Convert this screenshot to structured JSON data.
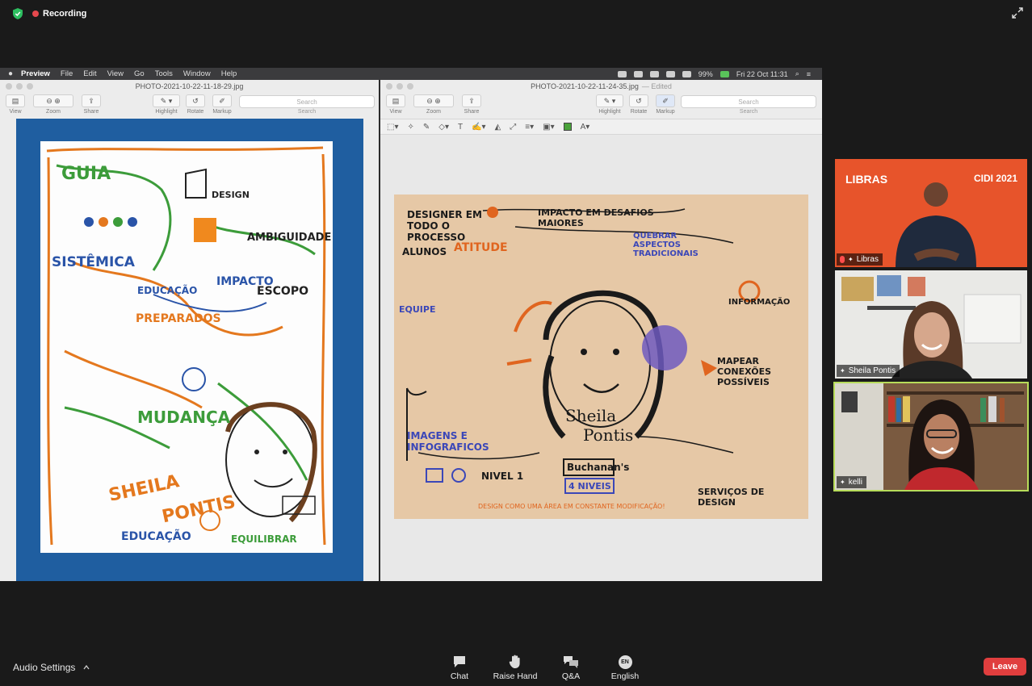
{
  "top_bar": {
    "recording_label": "Recording"
  },
  "mac_menubar": {
    "items": [
      "Preview",
      "File",
      "Edit",
      "View",
      "Go",
      "Tools",
      "Window",
      "Help"
    ],
    "battery": "99%",
    "clock": "Fri 22 Oct  11:31"
  },
  "preview_left": {
    "title": "PHOTO-2021-10-22-11-18-29.jpg",
    "toolbar": {
      "view": "View",
      "zoom": "Zoom",
      "share": "Share",
      "highlight": "Highlight",
      "rotate": "Rotate",
      "markup": "Markup",
      "search_placeholder": "Search",
      "search_label": "Search"
    },
    "sketch_text": {
      "guia": "GUIA",
      "sistemica": "SISTÊMICA",
      "impacto": "IMPACTO",
      "ambiguidade": "AMBIGUIDADE",
      "preparados": "PREPARADOS",
      "mudanca": "MUDANÇA",
      "sheila": "SHEILA",
      "pontis": "PONTIS",
      "educacao": "EDUCAÇÃO",
      "escopo": "ESCOPO",
      "equilibrar": "EQUILIBRAR",
      "design": "DESIGN"
    }
  },
  "preview_right": {
    "title": "PHOTO-2021-10-22-11-24-35.jpg",
    "edited": "— Edited",
    "toolbar": {
      "view": "View",
      "zoom": "Zoom",
      "share": "Share",
      "highlight": "Highlight",
      "rotate": "Rotate",
      "markup": "Markup",
      "search_placeholder": "Search",
      "search_label": "Search"
    },
    "sketch_text": {
      "designer": "DESIGNER EM TODO O PROCESSO",
      "impacto": "IMPACTO EM DESAFIOS MAIORES",
      "alunos": "ALUNOS",
      "atitude": "ATITUDE",
      "equipe": "EQUIPE",
      "sheila": "Sheila",
      "pontis": "Pontis",
      "imagens": "IMAGENS E INFOGRAFICOS",
      "nivel": "NIVEL 1",
      "buchanan": "Buchanan's",
      "niveis": "4 NIVEIS",
      "quebrar": "QUEBRAR ASPECTOS TRADICIONAIS",
      "informacao": "INFORMAÇÃO",
      "mapear": "MAPEAR CONEXÕES POSSÍVEIS",
      "servicos": "SERVIÇOS DE DESIGN",
      "footer": "DESIGN COMO UMA ÁREA EM CONSTANTE MODIFICAÇÃO!"
    }
  },
  "participants": [
    {
      "name": "Libras",
      "banner": "LIBRAS",
      "event": "CIDI 2021"
    },
    {
      "name": "Sheila Pontis"
    },
    {
      "name": "kelli"
    }
  ],
  "bottom_bar": {
    "audio_settings": "Audio Settings",
    "chat": "Chat",
    "raise_hand": "Raise Hand",
    "qa": "Q&A",
    "english_badge": "EN",
    "english": "English",
    "leave": "Leave"
  },
  "colors": {
    "leave": "#e03e3e",
    "active_speaker_border": "#b7dc5a",
    "recording_dot": "#e5484d",
    "libras_bg": "#e7542b"
  }
}
